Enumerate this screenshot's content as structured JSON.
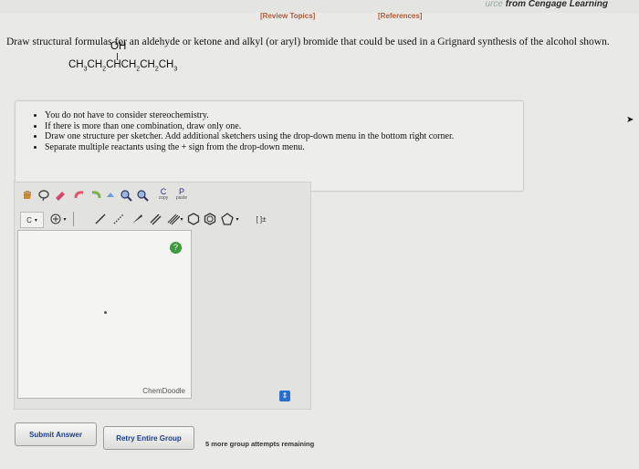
{
  "brand": {
    "prefix": "urce",
    "name": "from Cengage Learning"
  },
  "links": {
    "review": "[Review Topics]",
    "references": "[References]"
  },
  "question": "Draw structural formulas for an aldehyde or ketone and alkyl (or aryl) bromide that could be used in a Grignard synthesis of the alcohol shown.",
  "molecule": {
    "oh": "OH"
  },
  "instructions": [
    "You do not have to consider stereochemistry.",
    "If there is more than one combination, draw only one.",
    "Draw one structure per sketcher. Add additional sketchers using the drop-down menu in the bottom right corner.",
    "Separate multiple reactants using the + sign from the drop-down menu."
  ],
  "toolbar": {
    "copy": "copy",
    "paste": "paste",
    "copy_letter": "C",
    "paste_letter": "P",
    "c_label": "C",
    "bracket": "[ ]±"
  },
  "sketcher": {
    "brand": "ChemDoodle"
  },
  "buttons": {
    "submit": "Submit Answer",
    "retry": "Retry Entire Group"
  },
  "attempts": "5 more group attempts remaining",
  "colors": {
    "accent": "#1a3e8e",
    "link": "#b05a3a",
    "green": "#3d9a3d",
    "blue": "#2a6fc9"
  }
}
